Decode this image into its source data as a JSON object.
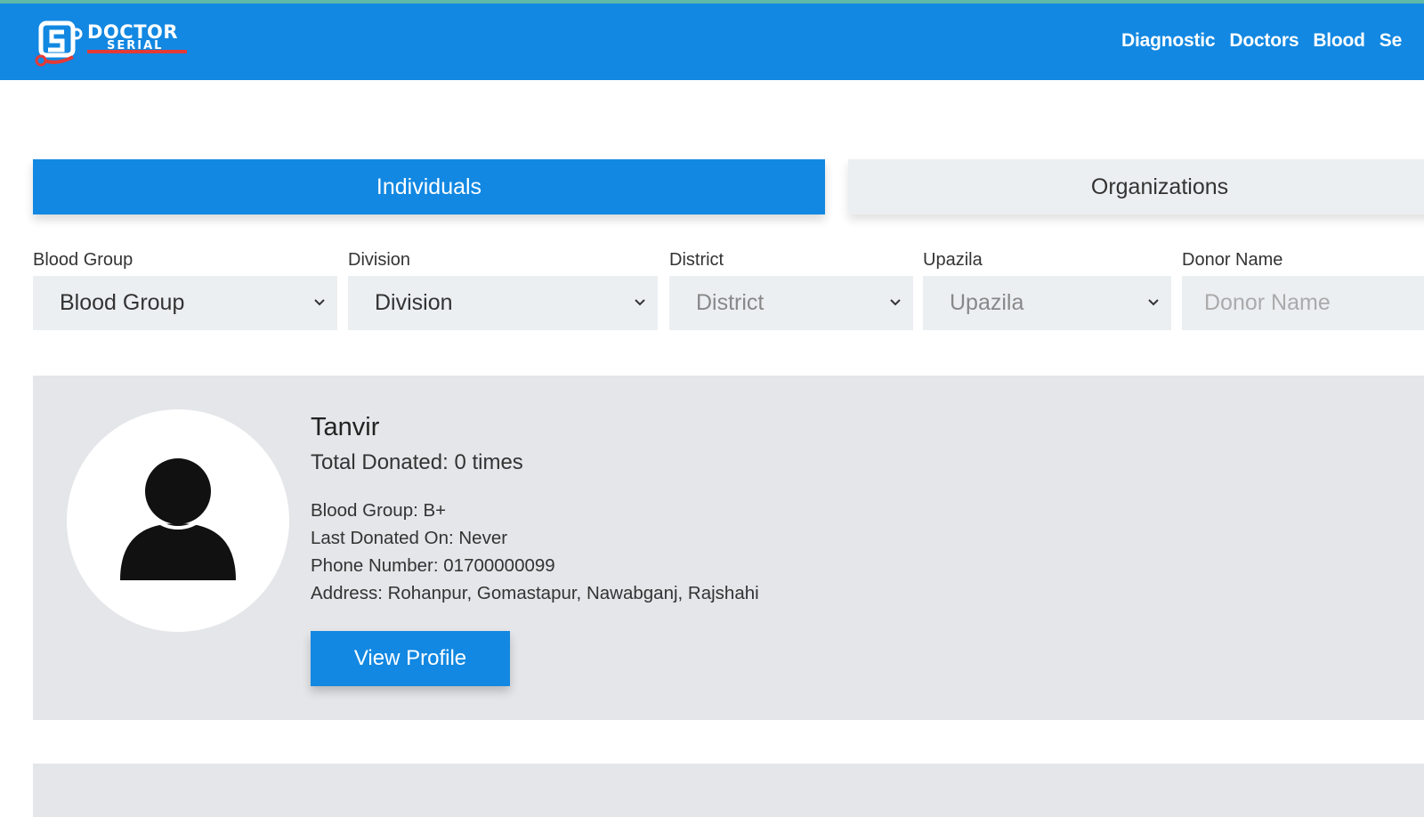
{
  "header": {
    "logo_line1": "DOCTOR",
    "logo_line2": "SERIAL",
    "nav": [
      "Diagnostic",
      "Doctors",
      "Blood",
      "Se"
    ],
    "bg_color": "#1288e2"
  },
  "tabs": [
    {
      "label": "Individuals",
      "active": true
    },
    {
      "label": "Organizations",
      "active": false
    }
  ],
  "filters": {
    "blood_group": {
      "label": "Blood Group",
      "value": "Blood Group"
    },
    "division": {
      "label": "Division",
      "value": "Division"
    },
    "district": {
      "label": "District",
      "value": "District"
    },
    "upazila": {
      "label": "Upazila",
      "value": "Upazila"
    },
    "donor_name": {
      "label": "Donor Name",
      "placeholder": "Donor Name"
    }
  },
  "donor": {
    "name": "Tanvir",
    "total_donated": "Total Donated: 0 times",
    "blood_group": "Blood Group: B+",
    "last_donated": "Last Donated On: Never",
    "phone": "Phone Number: 01700000099",
    "address": "Address: Rohanpur, Gomastapur, Nawabganj, Rajshahi",
    "view_profile_label": "View Profile",
    "avatar_icon": "user-silhouette-icon"
  }
}
